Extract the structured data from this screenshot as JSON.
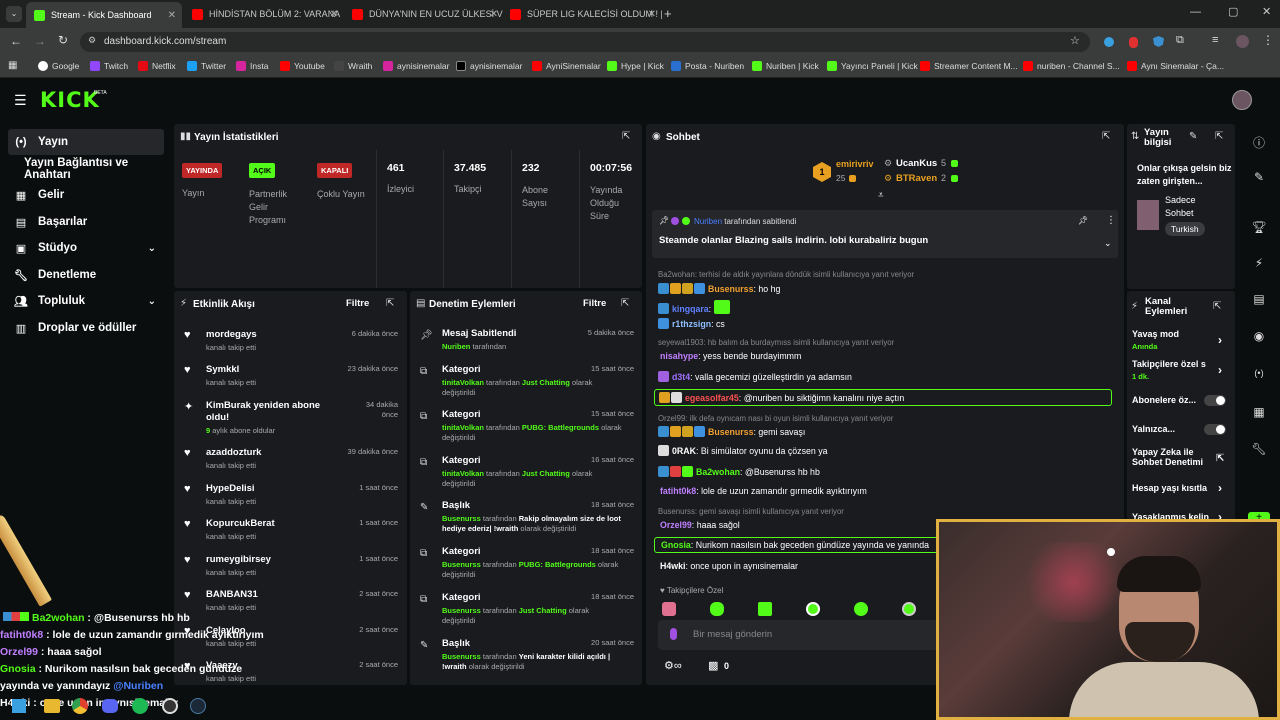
{
  "browser": {
    "tabs": [
      {
        "label": "Stream - Kick Dashboard",
        "active": true
      },
      {
        "label": "HİNDİSTAN BÖLÜM 2: VARANA"
      },
      {
        "label": "DÜNYA'NIN EN UCUZ ÜLKESİ V"
      },
      {
        "label": "SÜPER LIG KALECİSİ OLDUM ! |"
      }
    ],
    "url": "dashboard.kick.com/stream",
    "bookmarks": [
      "Google",
      "Twitch",
      "Netflix",
      "Twitter",
      "Insta",
      "Youtube",
      "Wraith",
      "aynisinemalar",
      "aynisinemalar",
      "AyniSinemalar",
      "Hype | Kick",
      "Posta - Nuriben",
      "Nuriben | Kick",
      "Yayıncı Paneli | Kick",
      "Streamer Content M...",
      "nuriben - Channel S...",
      "Aynı Sinemalar - Ça..."
    ]
  },
  "brand": {
    "logo": "KICK",
    "beta": "BETA"
  },
  "nav": {
    "items": [
      "Yayın",
      "Yayın Bağlantısı ve Anahtarı",
      "Gelir",
      "Başarılar",
      "Stüdyo",
      "Denetleme",
      "Topluluk",
      "Droplar ve ödüller"
    ]
  },
  "stats": {
    "title": "Yayın İstatistikleri",
    "badges": [
      {
        "badge": "YAYINDA",
        "label": "Yayın"
      },
      {
        "badge": "AÇIK",
        "label": "Partnerlik Gelir Programı"
      },
      {
        "badge": "KAPALI",
        "label": "Çoklu Yayın"
      }
    ],
    "numbers": [
      {
        "value": "461",
        "label": "İzleyici"
      },
      {
        "value": "37.485",
        "label": "Takipçi"
      },
      {
        "value": "232",
        "label": "Abone Sayısı"
      },
      {
        "value": "00:07:56",
        "label": "Yayında Olduğu Süre"
      }
    ]
  },
  "activity": {
    "title": "Etkinlik Akışı",
    "filter": "Filtre",
    "items": [
      {
        "name": "mordegays",
        "sub": "kanalı takip etti",
        "time": "6 dakika önce"
      },
      {
        "name": "Symkkl",
        "sub": "kanalı takip etti",
        "time": "23 dakika önce"
      },
      {
        "name": "KimBurak yeniden abone oldu!",
        "sub": "aylık abone oldular",
        "months": "9",
        "time": "34 dakika önce"
      },
      {
        "name": "azaddozturk",
        "sub": "kanalı takip etti",
        "time": "39 dakika önce"
      },
      {
        "name": "HypeDelisi",
        "sub": "kanalı takip etti",
        "time": "1 saat önce"
      },
      {
        "name": "KopurcukBerat",
        "sub": "kanalı takip etti",
        "time": "1 saat önce"
      },
      {
        "name": "rumeygibirsey",
        "sub": "kanalı takip etti",
        "time": "1 saat önce"
      },
      {
        "name": "BANBAN31",
        "sub": "kanalı takip etti",
        "time": "2 saat önce"
      },
      {
        "name": "Celayloo",
        "sub": "kanalı takip etti",
        "time": "2 saat önce"
      },
      {
        "name": "Vaaezy",
        "sub": "kanalı takip etti",
        "time": "2 saat önce"
      }
    ]
  },
  "modlog": {
    "title": "Denetim Eylemleri",
    "filter": "Filtre",
    "items": [
      {
        "kind": "Mesaj Sabitlendi",
        "user": "Nuriben",
        "mid": "tarafından",
        "target": "",
        "end": "",
        "time": "5 dakika önce"
      },
      {
        "kind": "Kategori",
        "user": "tinitaVolkan",
        "mid": "tarafından",
        "target": "Just Chatting",
        "end": "olarak değiştirildi",
        "time": "15 saat önce"
      },
      {
        "kind": "Kategori",
        "user": "tinitaVolkan",
        "mid": "tarafından",
        "target": "PUBG: Battlegrounds",
        "end": "olarak değiştirildi",
        "time": "15 saat önce"
      },
      {
        "kind": "Kategori",
        "user": "tinitaVolkan",
        "mid": "tarafından",
        "target": "Just Chatting",
        "end": "olarak değiştirildi",
        "time": "16 saat önce"
      },
      {
        "kind": "Başlık",
        "user": "Busenurss",
        "mid": "tarafından",
        "target": "Rakip olmayalım size de loot hediye ederiz| !wraith",
        "end": "olarak değiştirildi",
        "time": "18 saat önce"
      },
      {
        "kind": "Kategori",
        "user": "Busenurss",
        "mid": "tarafından",
        "target": "PUBG: Battlegrounds",
        "end": "olarak değiştirildi",
        "time": "18 saat önce"
      },
      {
        "kind": "Kategori",
        "user": "Busenurss",
        "mid": "tarafından",
        "target": "Just Chatting",
        "end": "olarak değiştirildi",
        "time": "18 saat önce"
      },
      {
        "kind": "Başlık",
        "user": "Busenurss",
        "mid": "tarafından",
        "target": "Yeni karakter kilidi açıldı | !wraith",
        "end": "olarak değiştirildi",
        "time": "20 saat önce"
      }
    ]
  },
  "chat": {
    "title": "Sohbet",
    "leaders": [
      {
        "name": "emirivriv",
        "num": "25",
        "rank": "1"
      },
      {
        "name": "UcanKus",
        "num": "5"
      },
      {
        "name": "BTRaven",
        "num": "2"
      }
    ],
    "pinned": {
      "by": "Nuriben",
      "by_suffix": "tarafından sabitlendi",
      "text": "Steamde olanlar Blazing sails indirin. lobi kurabaliriz bugun"
    },
    "lines": [
      {
        "type": "reply",
        "text": "Ba2wohan: terhisi de aldık yayınlara döndük isimli kullanıcıya yanıt veriyor"
      },
      {
        "type": "msg",
        "user": "Busenurss",
        "color": "#f0a030",
        "text": "ho hg",
        "emotes": [
          "#3a8fd0",
          "#e0a020",
          "#d0a020",
          "#4090e0"
        ]
      },
      {
        "type": "msg",
        "user": "kingqara",
        "color": "#6080ff",
        "text": "",
        "emotes": [
          "#3a8fd0"
        ]
      },
      {
        "type": "msg",
        "user": "r1thzsign",
        "color": "#90c0ff",
        "text": "cs",
        "emotes": [
          "#4090e0"
        ]
      },
      {
        "type": "reply",
        "text": "seyewal1903: hb balım da burdaymıss isimli kullanıcıya yanıt veriyor"
      },
      {
        "type": "msg",
        "user": "nisahype",
        "color": "#c080ff",
        "text": "yess bende burdayimmm",
        "emotes": []
      },
      {
        "type": "msg",
        "user": "d3t4",
        "color": "#a070ff",
        "text": "valla gecemizi güzelleştirdin ya adamsın",
        "emotes": [
          "#a060e0"
        ]
      },
      {
        "type": "msg",
        "user": "egeasolfar45",
        "color": "#ff5050",
        "text": "@nuriben bu siktiğimn kanalını niye açtın",
        "emotes": [
          "#e0a020",
          "#ddd"
        ],
        "highlight": true
      },
      {
        "type": "reply",
        "text": "Orzel99: ilk defa oynıcam nası bi oyun isimli kullanıcıya yanıt veriyor"
      },
      {
        "type": "msg",
        "user": "Busenurss",
        "color": "#f0a030",
        "text": "gemi savaşı",
        "emotes": [
          "#3a8fd0",
          "#e0a020",
          "#d0a020",
          "#4090e0"
        ]
      },
      {
        "type": "msg",
        "user": "0RAK",
        "color": "#ffffff",
        "text": "Bi simülator oyunu da çözsen ya",
        "emotes": [
          "#ddd"
        ]
      },
      {
        "type": "msg",
        "user": "Ba2wohan",
        "color": "#53fc18",
        "text": "@Busenurss hb hb",
        "emotes": [
          "#3a8fd0",
          "#e04040",
          "#53fc18"
        ]
      },
      {
        "type": "msg",
        "user": "fatiht0k8",
        "color": "#c080ff",
        "text": "lole de uzun zamandır gırmedik ayıktırıyım",
        "emotes": []
      },
      {
        "type": "reply",
        "text": "Busenurss: gemi savaşı isimli kullanıcıya yanıt veriyor"
      },
      {
        "type": "msg",
        "user": "Orzel99",
        "color": "#c080ff",
        "text": "haaa sağol",
        "emotes": []
      },
      {
        "type": "msg",
        "user": "Gnosia",
        "color": "#53fc18",
        "text": "Nurikom nasılsın bak geceden gündüze yayında ve yanında",
        "emotes": [],
        "highlight": true
      },
      {
        "type": "msg",
        "user": "H4wki",
        "color": "#ffffff",
        "text": "once upon in aynısinemalar",
        "emotes": []
      }
    ],
    "follower_only": "Takipçilere Özel",
    "input_placeholder": "Bir mesaj gönderin",
    "footer_count": "0"
  },
  "stream_info": {
    "title": "Yayın bilgisi",
    "text": "Onlar çıkışa gelsin biz zaten girişten...",
    "mode": "Sadece Sohbet",
    "lang": "Turkish"
  },
  "channel_actions": {
    "title": "Kanal Eylemleri",
    "items": [
      {
        "label": "Yavaş mod",
        "sub": "Anında",
        "kind": "chev"
      },
      {
        "label": "Takipçilere özel s",
        "sub": "1 dk.",
        "kind": "chev"
      },
      {
        "label": "Abonelere öz...",
        "kind": "toggle"
      },
      {
        "label": "Yalnızca...",
        "kind": "toggle"
      },
      {
        "label": "Yapay Zeka ile Sohbet Denetimi",
        "kind": "ext"
      },
      {
        "label": "Hesap yaşı kısıtla",
        "kind": "chev"
      },
      {
        "label": "Yasaklanmış kelin",
        "kind": "chev"
      }
    ]
  },
  "overlay": {
    "lines": [
      {
        "user": "Ba2wohan",
        "color": "#53fc18",
        "text": " : @Busenurss hb hb"
      },
      {
        "user": "fatiht0k8",
        "color": "#c080ff",
        "text": " : lole de uzun zamandır gırmedik ayıktırıyım"
      },
      {
        "user": "Orzel99",
        "color": "#c080ff",
        "text": " : haaa sağol"
      },
      {
        "user": "Gnosia",
        "color": "#53fc18",
        "text": " : Nurikom nasılsın bak geceden gündüze"
      },
      {
        "user": "",
        "color": "#fff",
        "text": "yayında ve yanındayız",
        "extra": "@Nuriben"
      },
      {
        "user": "H4wki",
        "color": "#fff",
        "text": " : once upon in aynısinemalar"
      }
    ]
  }
}
